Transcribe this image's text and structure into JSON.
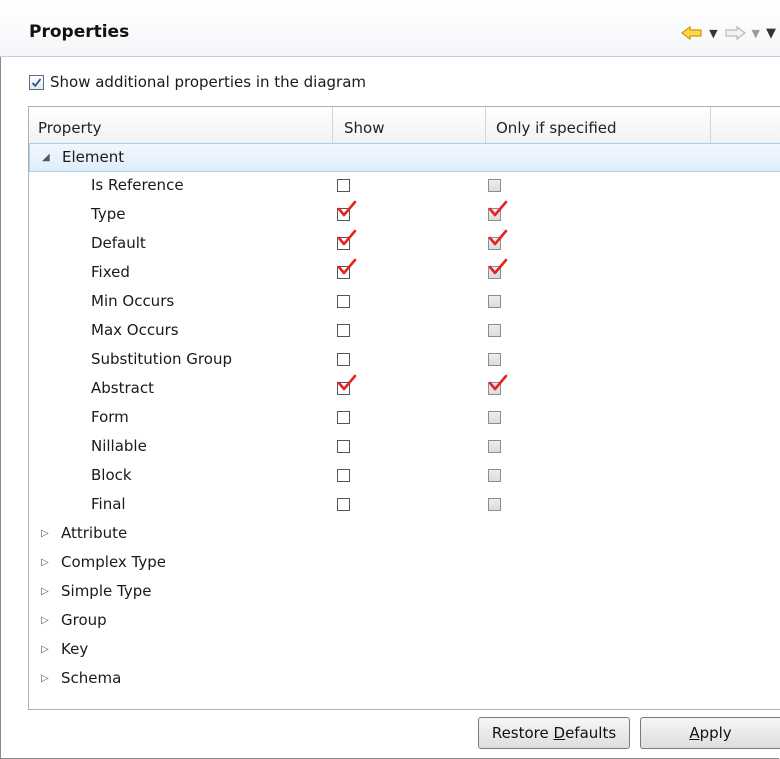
{
  "panel": {
    "title": "Properties"
  },
  "options": {
    "show_additional_label": "Show additional properties in the diagram",
    "show_additional_checked": true
  },
  "table": {
    "columns": [
      "Property",
      "Show",
      "Only if specified"
    ],
    "groups": [
      {
        "label": "Element",
        "expanded": true,
        "selected": true,
        "children": [
          {
            "label": "Is Reference",
            "show": false,
            "only_if_specified": false
          },
          {
            "label": "Type",
            "show": true,
            "only_if_specified": true
          },
          {
            "label": "Default",
            "show": true,
            "only_if_specified": true
          },
          {
            "label": "Fixed",
            "show": true,
            "only_if_specified": true
          },
          {
            "label": "Min Occurs",
            "show": false,
            "only_if_specified": false
          },
          {
            "label": "Max Occurs",
            "show": false,
            "only_if_specified": false
          },
          {
            "label": "Substitution Group",
            "show": false,
            "only_if_specified": false
          },
          {
            "label": "Abstract",
            "show": true,
            "only_if_specified": true
          },
          {
            "label": "Form",
            "show": false,
            "only_if_specified": false
          },
          {
            "label": "Nillable",
            "show": false,
            "only_if_specified": false
          },
          {
            "label": "Block",
            "show": false,
            "only_if_specified": false
          },
          {
            "label": "Final",
            "show": false,
            "only_if_specified": false
          }
        ]
      },
      {
        "label": "Attribute",
        "expanded": false
      },
      {
        "label": "Complex Type",
        "expanded": false
      },
      {
        "label": "Simple Type",
        "expanded": false
      },
      {
        "label": "Group",
        "expanded": false
      },
      {
        "label": "Key",
        "expanded": false
      },
      {
        "label": "Schema",
        "expanded": false
      }
    ]
  },
  "buttons": {
    "restore_prefix": "Restore ",
    "restore_mnemonic": "D",
    "restore_suffix": "efaults",
    "apply_mnemonic": "A",
    "apply_suffix": "pply"
  },
  "icons": {
    "back": "back-arrow-icon",
    "forward": "forward-arrow-icon",
    "menu": "view-menu-icon",
    "check": "check-icon",
    "expand": "tree-expand-icon",
    "collapse": "tree-collapse-icon"
  },
  "colors": {
    "check_red": "#e32424",
    "back_arrow": "#f0b400",
    "selection_border": "#a8cff0"
  }
}
